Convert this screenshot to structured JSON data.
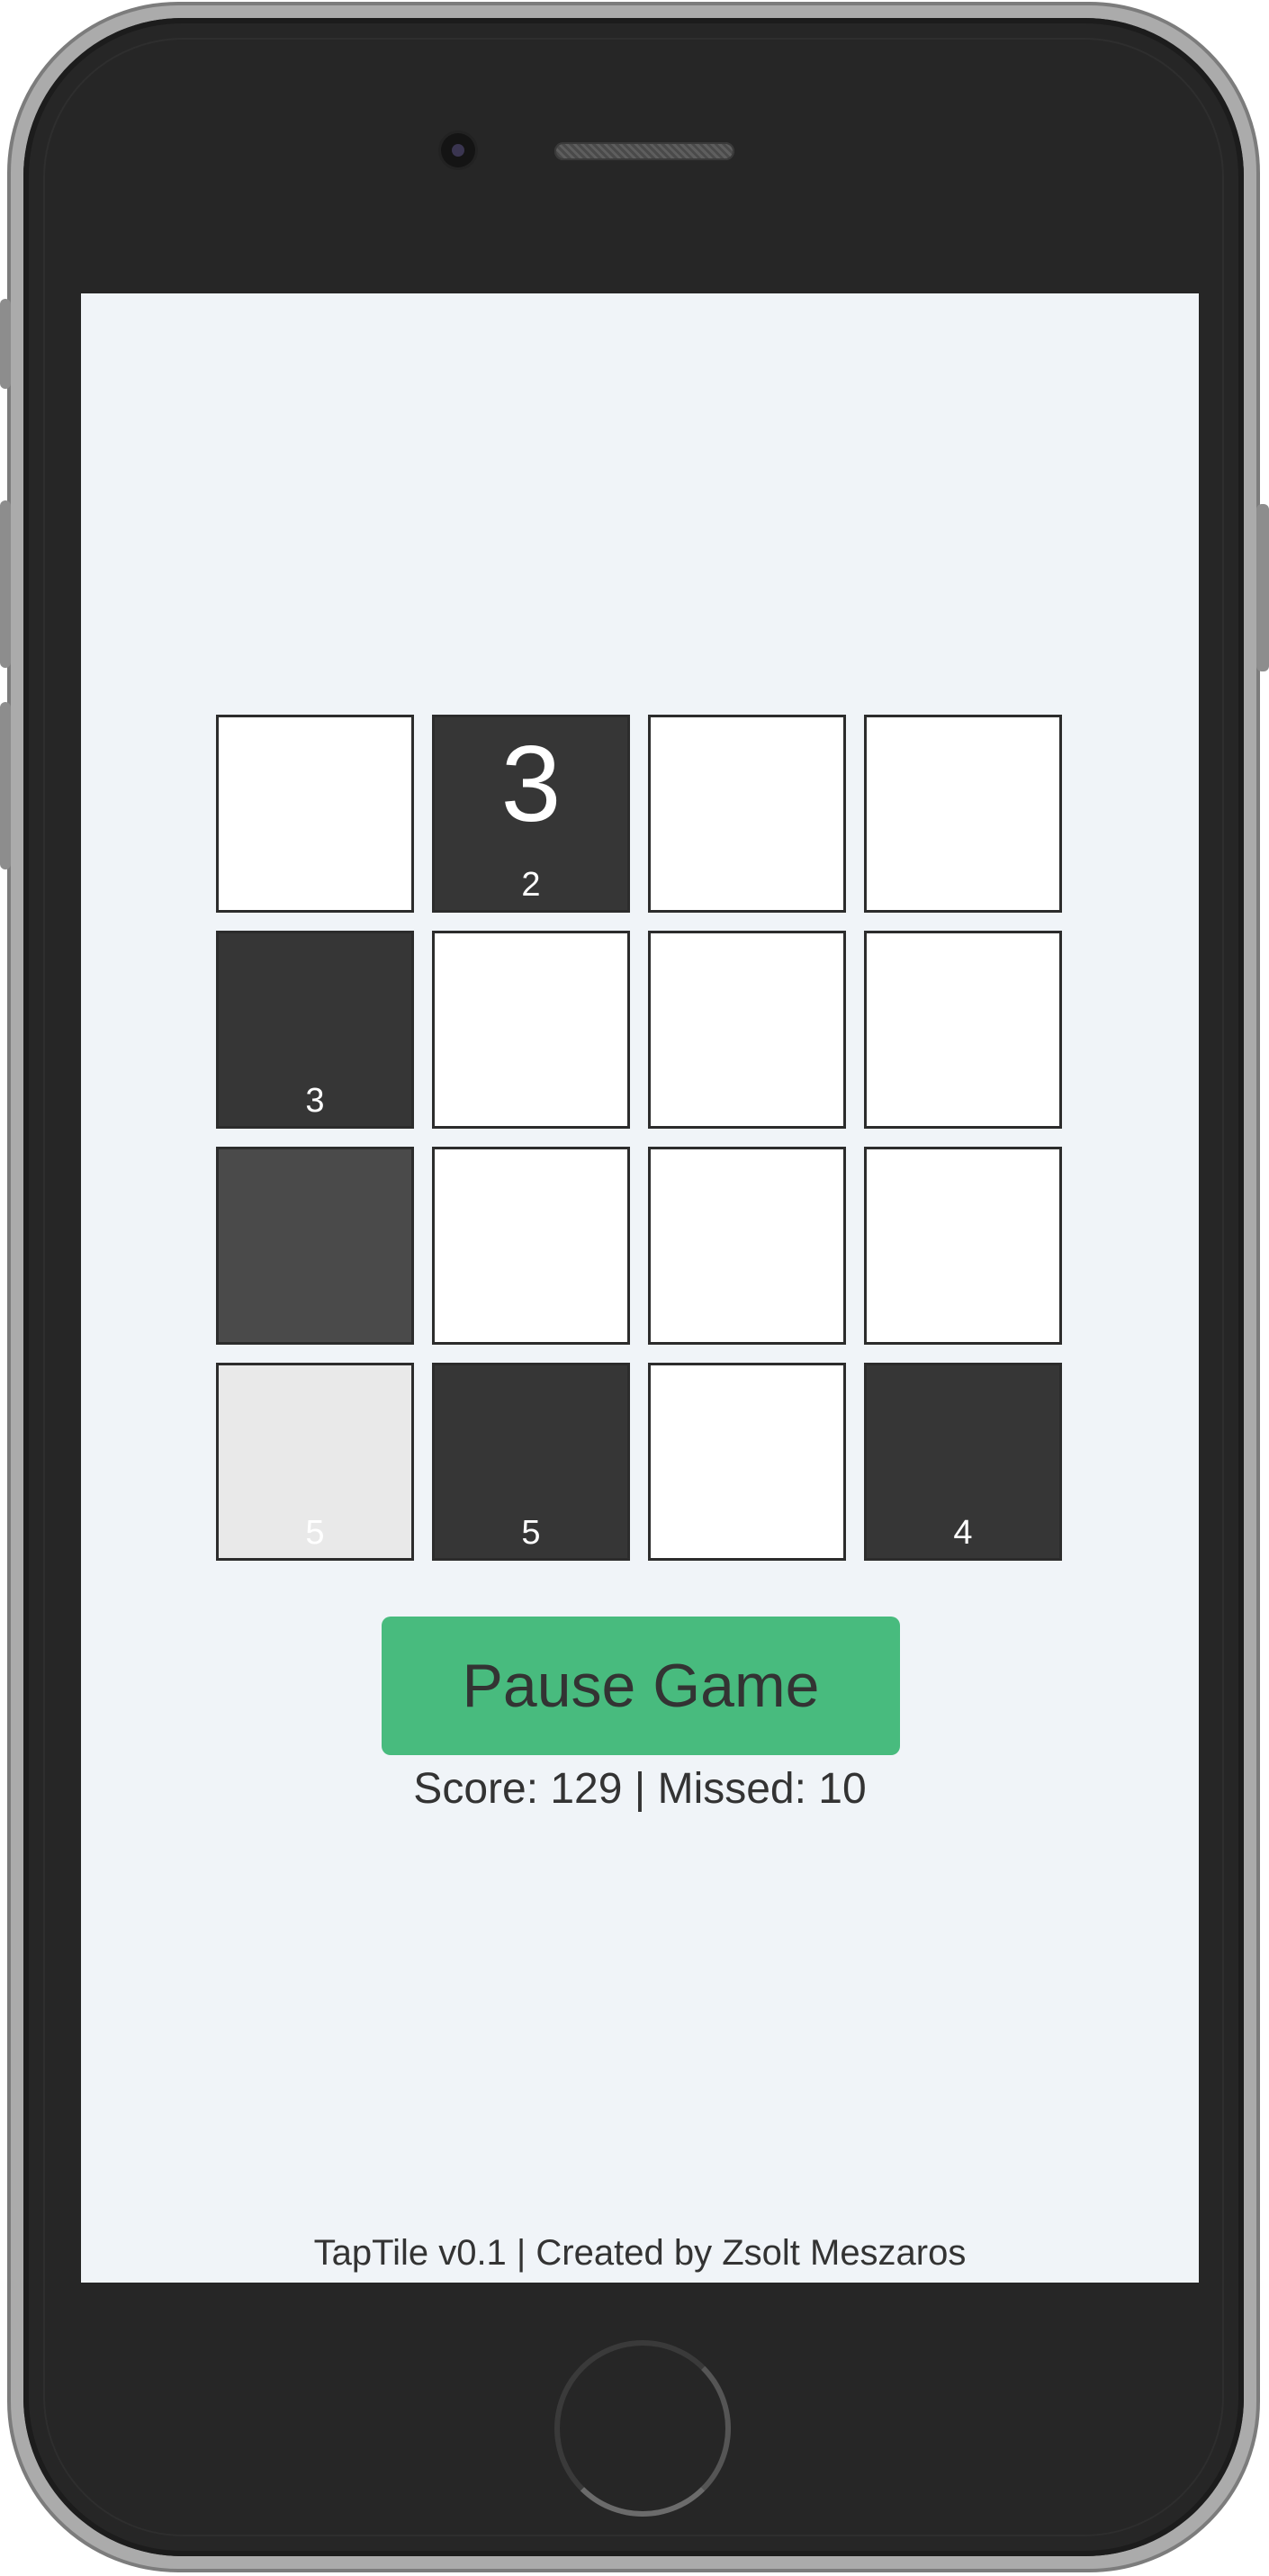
{
  "game": {
    "tiles": [
      {
        "shade": "white",
        "big": "",
        "small": ""
      },
      {
        "shade": "dark",
        "big": "3",
        "small": "2"
      },
      {
        "shade": "white",
        "big": "",
        "small": ""
      },
      {
        "shade": "white",
        "big": "",
        "small": ""
      },
      {
        "shade": "dark",
        "big": "",
        "small": "3"
      },
      {
        "shade": "white",
        "big": "",
        "small": ""
      },
      {
        "shade": "white",
        "big": "",
        "small": ""
      },
      {
        "shade": "white",
        "big": "",
        "small": ""
      },
      {
        "shade": "mid",
        "big": "",
        "small": ""
      },
      {
        "shade": "white",
        "big": "",
        "small": ""
      },
      {
        "shade": "white",
        "big": "",
        "small": ""
      },
      {
        "shade": "white",
        "big": "",
        "small": ""
      },
      {
        "shade": "light",
        "big": "",
        "small": "5"
      },
      {
        "shade": "dark",
        "big": "",
        "small": "5"
      },
      {
        "shade": "white",
        "big": "",
        "small": ""
      },
      {
        "shade": "dark",
        "big": "",
        "small": "4"
      }
    ],
    "pause_label": "Pause Game",
    "score_text": "Score: 129 | Missed: 10"
  },
  "footer": {
    "text": "TapTile v0.1 | Created by Zsolt Meszaros"
  },
  "colors": {
    "screen_bg": "#f0f4f8",
    "tile_white": "#ffffff",
    "tile_dark": "#363636",
    "tile_mid": "#4a4a4a",
    "tile_light": "#e9e9e9",
    "accent_green": "#48bb7e",
    "text": "#333333"
  }
}
